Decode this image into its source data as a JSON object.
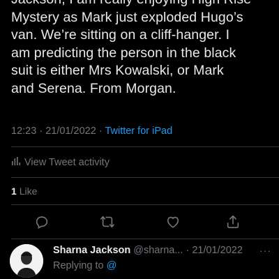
{
  "tweet": {
    "text": "Jackson, I am really enjoying High Rise\nMystery as Mark just exploded Hugo’s\nvan. We’re sitting on a cliff-hanger. I\nam predicting the person in the black\nsuit is either Mrs Kowalski, or Mark\nand Serena. From Morgan.",
    "time": "12:23",
    "separator": "·",
    "date": "21/01/2022",
    "source": "Twitter for iPad"
  },
  "activity": {
    "icon": "bar-chart-icon",
    "label": "View Tweet activity"
  },
  "likes": {
    "count": "1",
    "label": "Like"
  },
  "actions": [
    {
      "name": "reply",
      "icon": "comment-icon"
    },
    {
      "name": "retweet",
      "icon": "retweet-icon"
    },
    {
      "name": "like",
      "icon": "heart-icon"
    },
    {
      "name": "share",
      "icon": "share-icon"
    }
  ],
  "reply": {
    "name": "Sharna Jackson",
    "handle": "@sharna...",
    "separator": "·",
    "date": "21/01/2022",
    "more": "···",
    "replying_to_label": "Replying to",
    "replying_to_handle": "@"
  },
  "colors": {
    "background": "#000000",
    "text": "#e7e9ea",
    "muted": "#71767b",
    "accent": "#1d9bf0",
    "divider": "#2f3336"
  }
}
